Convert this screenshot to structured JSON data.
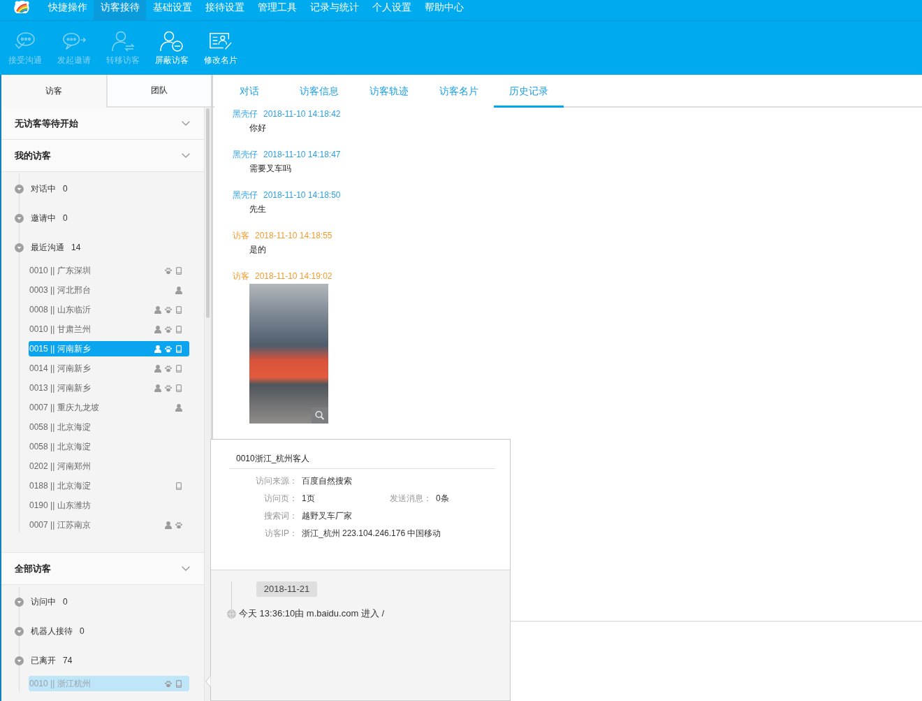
{
  "top_menu": [
    {
      "label": "快捷操作",
      "selected": false
    },
    {
      "label": "访客接待",
      "selected": true
    },
    {
      "label": "基础设置",
      "selected": false
    },
    {
      "label": "接待设置",
      "selected": false
    },
    {
      "label": "管理工具",
      "selected": false
    },
    {
      "label": "记录与统计",
      "selected": false
    },
    {
      "label": "个人设置",
      "selected": false
    },
    {
      "label": "帮助中心",
      "selected": false
    }
  ],
  "toolbar": [
    {
      "kind": "accept_chat",
      "label": "接受沟通",
      "disabled": true
    },
    {
      "kind": "invite",
      "label": "发起邀请",
      "disabled": true
    },
    {
      "kind": "transfer",
      "label": "转移访客",
      "disabled": true
    },
    {
      "kind": "block",
      "label": "屏蔽访客",
      "disabled": false
    },
    {
      "kind": "edit_card",
      "label": "修改名片",
      "disabled": false
    }
  ],
  "sidebar": {
    "tabs": [
      {
        "label": "访客",
        "selected": true
      },
      {
        "label": "团队",
        "selected": false
      }
    ],
    "sections": [
      {
        "title": "无访客等待开始"
      },
      {
        "title": "我的访客",
        "groups": [
          {
            "label": "对话中",
            "count": "0"
          },
          {
            "label": "邀请中",
            "count": "0"
          },
          {
            "label": "最近沟通",
            "count": "14",
            "visitors": [
              {
                "label": "0010 || 广东深圳",
                "icons": [
                  {
                    "kind": "paw"
                  },
                  {
                    "kind": "phone"
                  }
                ],
                "selected": false,
                "hovered": false
              },
              {
                "label": "0003 || 河北邢台",
                "icons": [
                  {
                    "kind": "person"
                  }
                ],
                "selected": false,
                "hovered": false
              },
              {
                "label": "0008 || 山东临沂",
                "icons": [
                  {
                    "kind": "person"
                  },
                  {
                    "kind": "paw"
                  },
                  {
                    "kind": "phone"
                  }
                ],
                "selected": false,
                "hovered": false
              },
              {
                "label": "0010 || 甘肃兰州",
                "icons": [
                  {
                    "kind": "person"
                  },
                  {
                    "kind": "paw"
                  },
                  {
                    "kind": "phone"
                  }
                ],
                "selected": false,
                "hovered": false
              },
              {
                "label": "0015 || 河南新乡",
                "icons": [
                  {
                    "kind": "person"
                  },
                  {
                    "kind": "paw"
                  },
                  {
                    "kind": "phone"
                  }
                ],
                "selected": true,
                "hovered": false
              },
              {
                "label": "0014 || 河南新乡",
                "icons": [
                  {
                    "kind": "person"
                  },
                  {
                    "kind": "paw"
                  },
                  {
                    "kind": "phone"
                  }
                ],
                "selected": false,
                "hovered": false
              },
              {
                "label": "0013 || 河南新乡",
                "icons": [
                  {
                    "kind": "person"
                  },
                  {
                    "kind": "paw"
                  },
                  {
                    "kind": "phone"
                  }
                ],
                "selected": false,
                "hovered": false
              },
              {
                "label": "0007 || 重庆九龙坡",
                "icons": [
                  {
                    "kind": "person"
                  }
                ],
                "selected": false,
                "hovered": false
              },
              {
                "label": "0058 || 北京海淀",
                "selected": false,
                "hovered": false
              },
              {
                "label": "0058 || 北京海淀",
                "selected": false,
                "hovered": false
              },
              {
                "label": "0202 || 河南郑州",
                "selected": false,
                "hovered": false
              },
              {
                "label": "0188 || 北京海淀",
                "icons": [
                  {
                    "kind": "phone"
                  }
                ],
                "selected": false,
                "hovered": false
              },
              {
                "label": "0190 || 山东潍坊",
                "selected": false,
                "hovered": false
              },
              {
                "label": "0007 || 江苏南京",
                "icons": [
                  {
                    "kind": "person"
                  },
                  {
                    "kind": "paw"
                  }
                ],
                "selected": false,
                "hovered": false
              }
            ]
          }
        ]
      },
      {
        "title": "全部访客",
        "groups": [
          {
            "label": "访问中",
            "count": "0"
          },
          {
            "label": "机器人接待",
            "count": "0"
          },
          {
            "label": "已离开",
            "count": "74",
            "visitors": [
              {
                "label": "0010 || 浙江杭州",
                "icons": [
                  {
                    "kind": "paw"
                  },
                  {
                    "kind": "phone"
                  }
                ],
                "selected": false,
                "hovered": true
              }
            ]
          }
        ]
      }
    ]
  },
  "chat_tabs": [
    {
      "label": "对话",
      "selected": false
    },
    {
      "label": "访客信息",
      "selected": false
    },
    {
      "label": "访客轨迹",
      "selected": false
    },
    {
      "label": "访客名片",
      "selected": false
    },
    {
      "label": "历史记录",
      "selected": true
    }
  ],
  "messages": [
    {
      "kind": "agent",
      "sender": "黑壳仔",
      "time": "2018-11-10 14:18:42",
      "text": "你好"
    },
    {
      "kind": "agent",
      "sender": "黑壳仔",
      "time": "2018-11-10 14:18:47",
      "text": "需要叉车吗"
    },
    {
      "kind": "agent",
      "sender": "黑壳仔",
      "time": "2018-11-10 14:18:50",
      "text": "先生"
    },
    {
      "kind": "visitor",
      "sender": "访客",
      "time": "2018-11-10 14:18:55",
      "text": "是的"
    },
    {
      "kind": "visitor",
      "sender": "访客",
      "time": "2018-11-10 14:19:02",
      "image": true
    }
  ],
  "visitor_card": {
    "title": "0010浙江_杭州客人",
    "rows": [
      {
        "fields": [
          {
            "label": "访问来源：",
            "value": "百度自然搜索"
          }
        ]
      },
      {
        "fields": [
          {
            "label": "访问页：",
            "value": "1页"
          },
          {
            "label": "发送消息：",
            "value": "0条"
          }
        ]
      },
      {
        "fields": [
          {
            "label": "搜索词：",
            "value": "越野叉车厂家"
          }
        ]
      },
      {
        "fields": [
          {
            "label": "访客IP：",
            "value": "浙江_杭州 223.104.246.176 中国移动"
          }
        ]
      }
    ],
    "history": {
      "date": "2018-11-21",
      "entries": [
        "今天 13:36:10由 m.baidu.com 进入 /"
      ]
    }
  }
}
